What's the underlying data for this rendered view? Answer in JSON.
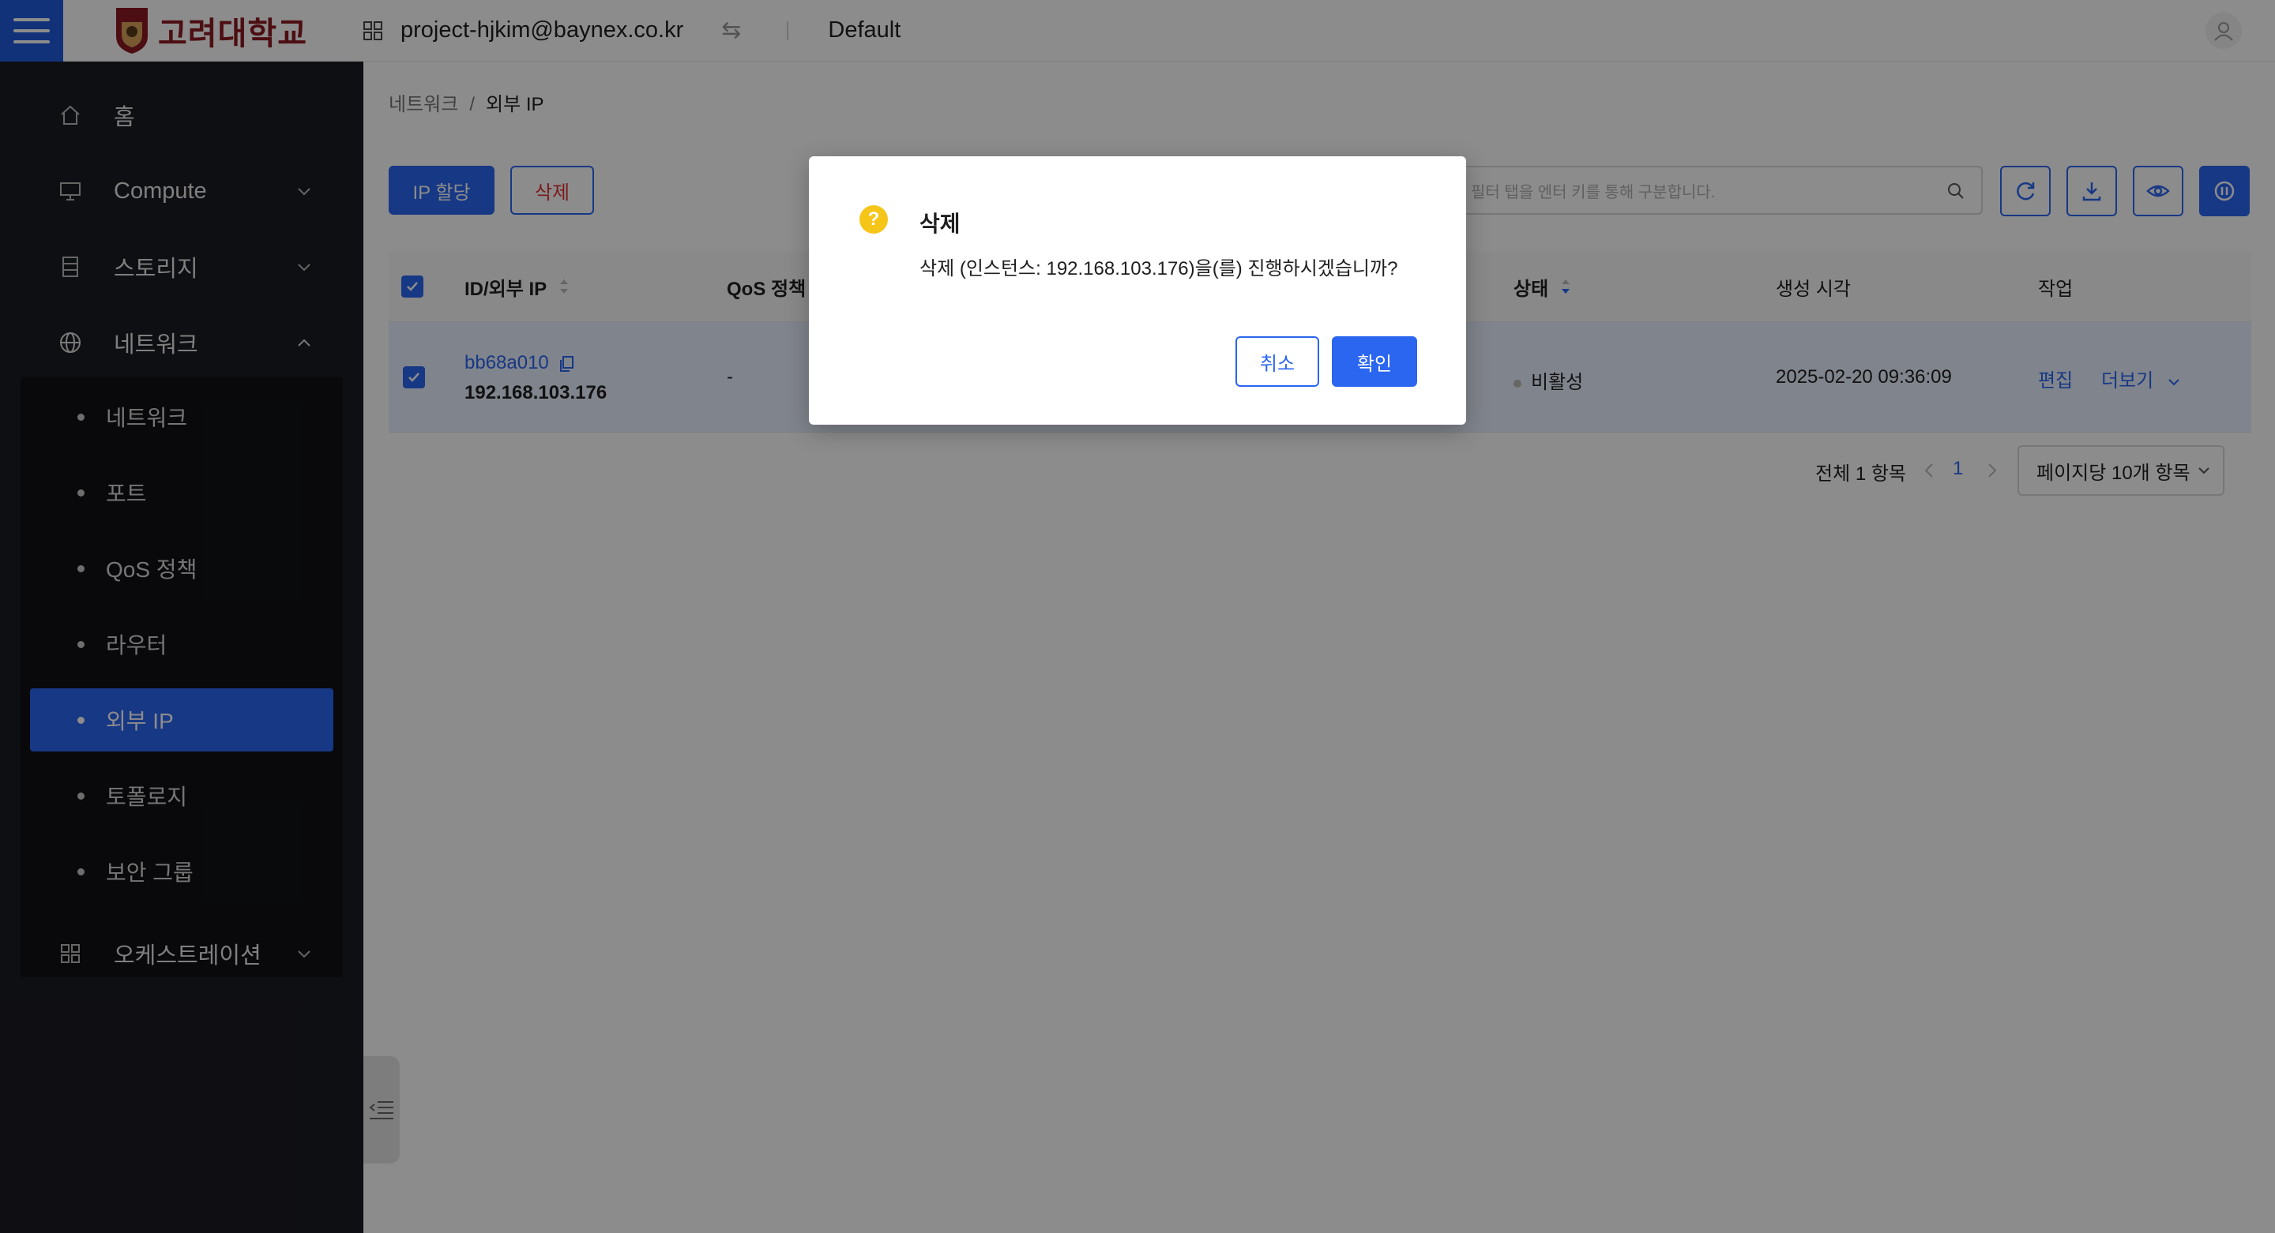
{
  "header": {
    "logo_text": "고려대학교",
    "logo_mark": "KOREA",
    "project": "project-hjkim@baynex.co.kr",
    "domain": "Default"
  },
  "sidebar": {
    "items": [
      {
        "label": "홈",
        "icon": "home-icon"
      },
      {
        "label": "Compute",
        "icon": "monitor-icon"
      },
      {
        "label": "스토리지",
        "icon": "storage-icon"
      },
      {
        "label": "네트워크",
        "icon": "globe-icon"
      },
      {
        "label": "오케스트레이션",
        "icon": "grid-icon"
      }
    ],
    "network_sub": [
      {
        "label": "네트워크"
      },
      {
        "label": "포트"
      },
      {
        "label": "QoS 정책"
      },
      {
        "label": "라우터"
      },
      {
        "label": "외부 IP"
      },
      {
        "label": "토폴로지"
      },
      {
        "label": "보안 그룹"
      }
    ]
  },
  "breadcrumb": {
    "parent": "네트워크",
    "separator": "/",
    "current": "외부 IP"
  },
  "toolbar": {
    "allocate_label": "IP 할당",
    "delete_label": "삭제",
    "search_placeholder": "필터 탭을 엔터 키를 통해 구분합니다."
  },
  "table": {
    "headers": {
      "id": "ID/외부 IP",
      "qos": "QoS 정책",
      "status": "상태",
      "created": "생성 시각",
      "action": "작업"
    },
    "row": {
      "id": "bb68a010",
      "ip": "192.168.103.176",
      "qos": "-",
      "status": "비활성",
      "created": "2025-02-20 09:36:09",
      "edit": "편집",
      "more": "더보기"
    }
  },
  "pagination": {
    "total": "전체 1 항목",
    "page": "1",
    "page_size": "페이지당 10개 항목"
  },
  "modal": {
    "title": "삭제",
    "message": "삭제 (인스턴스: 192.168.103.176)을(를) 진행하시겠습니까?",
    "cancel": "취소",
    "confirm": "확인",
    "icon_glyph": "?"
  },
  "colors": {
    "primary": "#2a66f0",
    "sidebar_bg": "#1b1c22",
    "danger": "#e03030",
    "warning": "#f5c518",
    "brand": "#8b1a22"
  }
}
